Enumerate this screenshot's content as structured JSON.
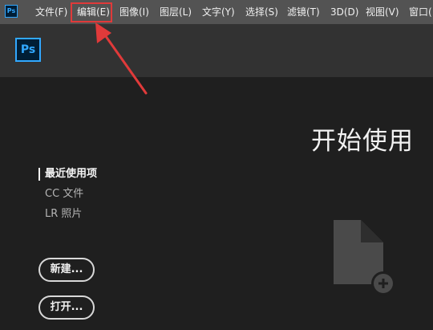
{
  "app": {
    "logo_small": "Ps",
    "logo": "Ps"
  },
  "menu": {
    "items": [
      {
        "label": "文件(F)"
      },
      {
        "label": "编辑(E)"
      },
      {
        "label": "图像(I)"
      },
      {
        "label": "图层(L)"
      },
      {
        "label": "文字(Y)"
      },
      {
        "label": "选择(S)"
      },
      {
        "label": "滤镜(T)"
      },
      {
        "label": "3D(D)"
      },
      {
        "label": "视图(V)"
      },
      {
        "label": "窗口("
      }
    ],
    "highlighted": "编辑(E)"
  },
  "main": {
    "title": "开始使用",
    "nav": [
      {
        "label": "最近使用项",
        "active": true
      },
      {
        "label": "CC 文件",
        "active": false
      },
      {
        "label": "LR 照片",
        "active": false
      }
    ],
    "buttons": {
      "new_label": "新建...",
      "open_label": "打开..."
    }
  },
  "icons": {
    "new_file": "new-document-icon",
    "annotation": "arrow-annotation"
  },
  "colors": {
    "menubar": "#535353",
    "header": "#323232",
    "background": "#1f1f1f",
    "accent": "#31a8ff",
    "annotation": "#e03a3a"
  }
}
